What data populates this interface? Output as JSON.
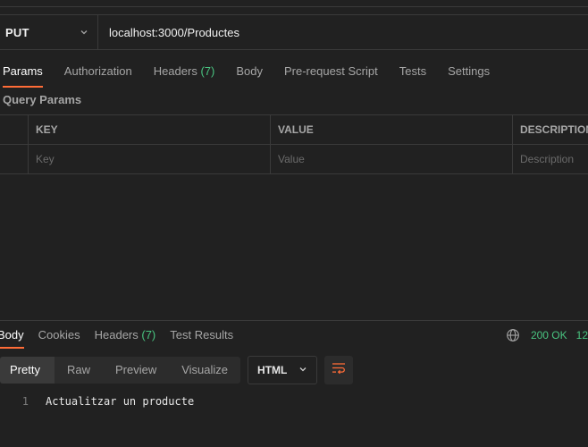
{
  "request": {
    "method": "PUT",
    "url": "localhost:3000/Productes"
  },
  "request_tabs": [
    {
      "label": "Params",
      "active": true
    },
    {
      "label": "Authorization"
    },
    {
      "label": "Headers",
      "count": "(7)"
    },
    {
      "label": "Body"
    },
    {
      "label": "Pre-request Script"
    },
    {
      "label": "Tests"
    },
    {
      "label": "Settings"
    }
  ],
  "params": {
    "title": "Query Params",
    "columns": {
      "key": "KEY",
      "value": "VALUE",
      "description": "DESCRIPTION"
    },
    "placeholders": {
      "key": "Key",
      "value": "Value",
      "description": "Description"
    }
  },
  "response": {
    "tabs": [
      {
        "label": "Body",
        "active": true
      },
      {
        "label": "Cookies"
      },
      {
        "label": "Headers",
        "count": "(7)"
      },
      {
        "label": "Test Results"
      }
    ],
    "status": "200 OK",
    "time": "12",
    "views": [
      "Pretty",
      "Raw",
      "Preview",
      "Visualize"
    ],
    "active_view": "Pretty",
    "format": "HTML",
    "lines": [
      {
        "num": "1",
        "text": "Actualitzar un producte"
      }
    ]
  },
  "colors": {
    "accent": "#ff6c37",
    "success": "#49c480",
    "background": "#212121"
  },
  "icons": [
    "chevron-down-icon",
    "globe-icon",
    "wrap-lines-icon"
  ]
}
